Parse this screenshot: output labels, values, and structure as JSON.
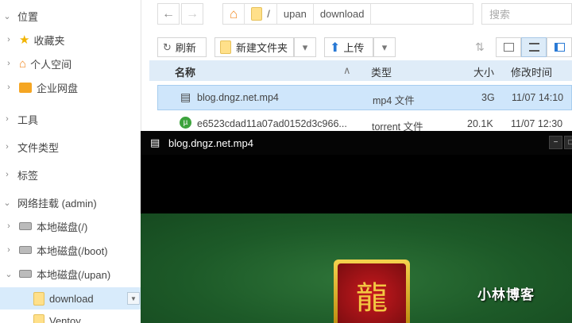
{
  "sidebar": {
    "items": [
      {
        "label": "位置",
        "chevron": "⌄"
      },
      {
        "label": "收藏夹",
        "chevron": "›"
      },
      {
        "label": "个人空间",
        "chevron": "›"
      },
      {
        "label": "企业网盘",
        "chevron": "›"
      },
      {
        "label": "工具",
        "chevron": "›"
      },
      {
        "label": "文件类型",
        "chevron": "›"
      },
      {
        "label": "标签",
        "chevron": "›"
      },
      {
        "label": "网络挂载 (admin)",
        "chevron": "⌄"
      },
      {
        "label": "本地磁盘(/)",
        "chevron": "›"
      },
      {
        "label": "本地磁盘(/boot)",
        "chevron": "›"
      },
      {
        "label": "本地磁盘(/upan)",
        "chevron": "⌄"
      },
      {
        "label": "download",
        "chevron": ""
      },
      {
        "label": "Ventoy",
        "chevron": ""
      }
    ]
  },
  "nav": {
    "back": "←",
    "forward": "→",
    "home": "⌂"
  },
  "breadcrumb": [
    "/",
    "upan",
    "download"
  ],
  "search": {
    "placeholder": "搜索"
  },
  "toolbar": {
    "refresh_label": "刷新",
    "new_folder_label": "新建文件夹",
    "upload_label": "上传",
    "dropdown_glyph": "▾"
  },
  "table": {
    "headers": {
      "name": "名称",
      "type": "类型",
      "size": "大小",
      "modified": "修改时间",
      "sort_glyph": "∧"
    },
    "rows": [
      {
        "name": "blog.dngz.net.mp4",
        "type": "mp4 文件",
        "size": "3G",
        "modified": "11/07 14:10"
      },
      {
        "name": "e6523cdad11a07ad0152d3c966...",
        "type": "torrent 文件",
        "size": "20.1K",
        "modified": "11/07 12:30"
      }
    ]
  },
  "player": {
    "title": "blog.dngz.net.mp4",
    "minimize": "−",
    "maximize": "□",
    "watermark": "小林博客",
    "emblem_glyph": "龍"
  }
}
